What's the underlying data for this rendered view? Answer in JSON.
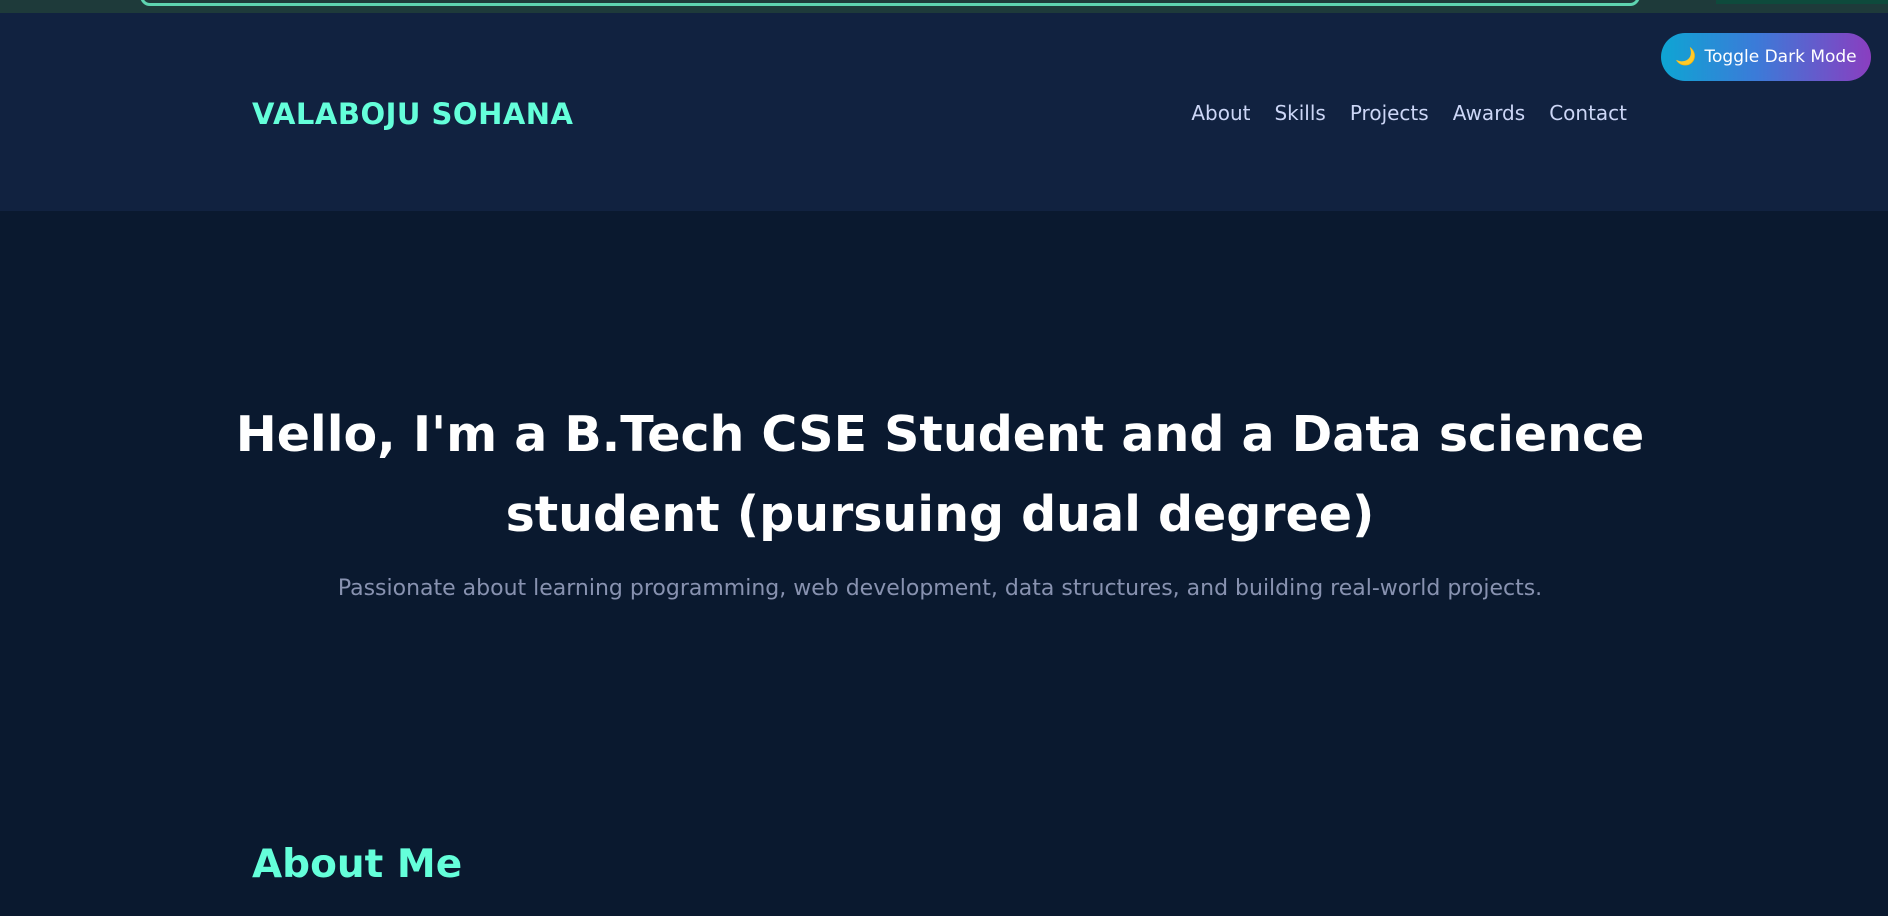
{
  "header": {
    "brand": "VALABOJU SOHANA",
    "nav": [
      {
        "label": "About"
      },
      {
        "label": "Skills"
      },
      {
        "label": "Projects"
      },
      {
        "label": "Awards"
      },
      {
        "label": "Contact"
      }
    ]
  },
  "toggle": {
    "icon": "moon-icon",
    "icon_glyph": "🌙",
    "label": "Toggle Dark Mode"
  },
  "hero": {
    "title": "Hello, I'm a B.Tech CSE Student and a Data science student (pursuing dual degree)",
    "subtitle": "Passionate about learning programming, web development, data structures, and building real-world projects."
  },
  "about": {
    "heading": "About Me"
  },
  "colors": {
    "background": "#0a192f",
    "header_bg": "#112240",
    "accent": "#64ffda",
    "nav_text": "#ccd6f6",
    "muted_text": "#8892b0"
  }
}
